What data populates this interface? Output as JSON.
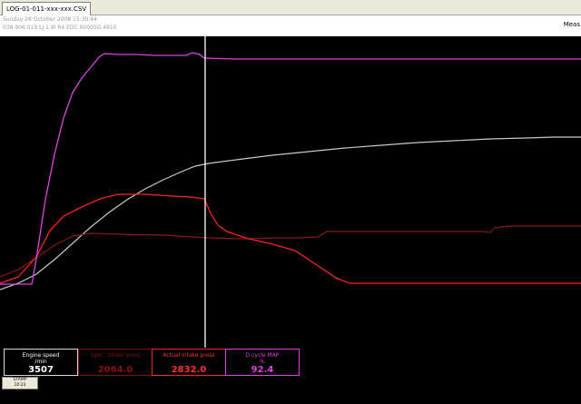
{
  "tab": {
    "label": "LOG-01-011-xxx-xxx.CSV"
  },
  "info": {
    "date_line": "Sunday 26 October 2008 15:30:44",
    "ecu_line": "038 906 019 LJ 1.9l R4 EDC 0000SG 4910"
  },
  "measure_label": "Meas",
  "gauges": [
    {
      "label": "Engine speed",
      "unit": "/min",
      "value": "3507",
      "color": "#ffffff",
      "border": "#d8d8d8"
    },
    {
      "label": "Spec. intake press",
      "unit": "",
      "value": "2064.0",
      "color": "#8a1010",
      "border": "#7a1010"
    },
    {
      "label": "Actual intake press",
      "unit": "",
      "value": "2832.0",
      "color": "#ff3030",
      "border": "#ff2020"
    },
    {
      "label": "D cycle MAP",
      "unit": "%",
      "value": "92.4",
      "color": "#e040e0",
      "border": "#e040e0"
    }
  ],
  "stamp": {
    "label": "STAMP",
    "time": "10:23"
  },
  "colors": {
    "plot_bg": "#000000",
    "cursor": "#ffffff",
    "engine_speed": "#c8c8c8",
    "spec_intake": "#8a1818",
    "actual_intake": "#ff2020",
    "duty_cycle": "#e040e0"
  }
}
